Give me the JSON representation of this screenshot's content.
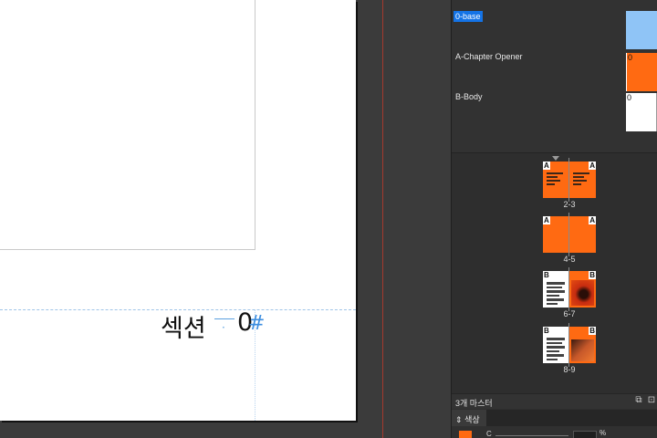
{
  "canvas": {
    "section_text": "섹션",
    "section_number": "0",
    "section_hash": "#",
    "section_dot": "·"
  },
  "masters": [
    {
      "label": "0-base",
      "selected": true,
      "thumb_style": "blue",
      "thumb_letter": ""
    },
    {
      "label": "A-Chapter Opener",
      "selected": false,
      "thumb_style": "orange",
      "thumb_letter": "0"
    },
    {
      "label": "B-Body",
      "selected": false,
      "thumb_style": "white",
      "thumb_letter": "0"
    }
  ],
  "spreads": [
    {
      "pages": "2-3",
      "left_master": "A",
      "right_master": "A",
      "style": "orange-text"
    },
    {
      "pages": "4-5",
      "left_master": "A",
      "right_master": "A",
      "style": "orange-plain"
    },
    {
      "pages": "6-7",
      "left_master": "B",
      "right_master": "B",
      "style": "body-red"
    },
    {
      "pages": "8-9",
      "left_master": "B",
      "right_master": "B",
      "style": "body-orange"
    }
  ],
  "footer": {
    "status": "3개 마스터",
    "icons": [
      "new-page-icon",
      "delete-page-icon"
    ]
  },
  "color_panel": {
    "tab_label": "색상",
    "tab_icon": "⇕",
    "channel": "C",
    "percent": "%",
    "swatch_color": "#ff6a12"
  },
  "colors": {
    "accent_orange": "#ff6a12",
    "selection_blue": "#1473e6",
    "guide_red": "#c0392b"
  }
}
